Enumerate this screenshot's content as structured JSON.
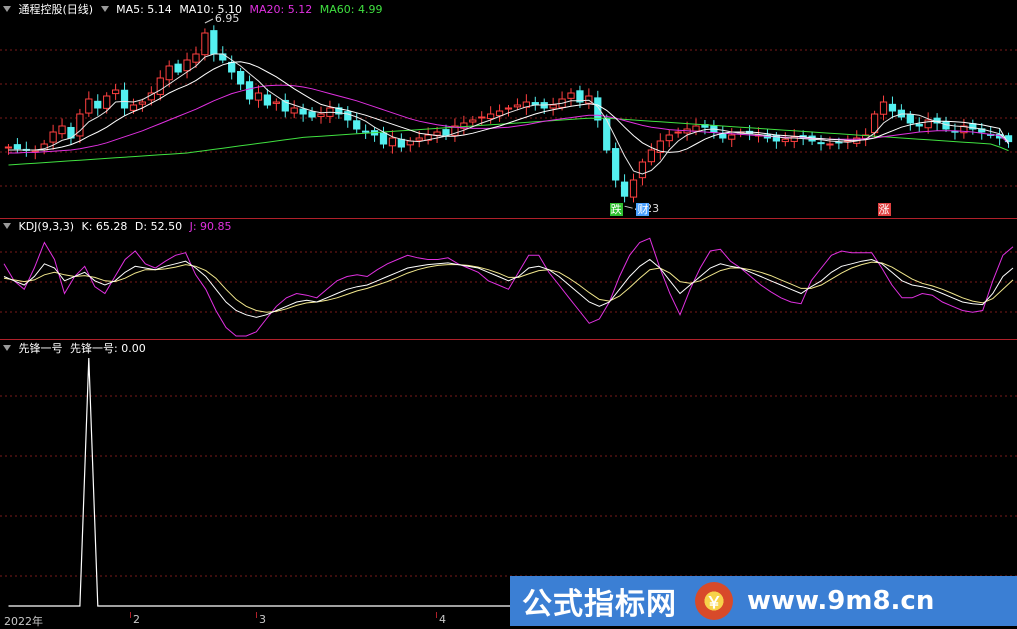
{
  "chart_data": [
    {
      "type": "candlestick",
      "title": "通程控股(日线)",
      "legend": [
        {
          "label": "MA5: 5.14",
          "color": "#ffffff"
        },
        {
          "label": "MA10: 5.10",
          "color": "#ffffff"
        },
        {
          "label": "MA20: 5.12",
          "color": "#e030e0"
        },
        {
          "label": "MA60: 4.99",
          "color": "#40e040"
        }
      ],
      "annotations": {
        "high_label": "6.95",
        "low_label": "4.23"
      },
      "tags": [
        {
          "text": "跌",
          "color": "#30c030"
        },
        {
          "text": "财",
          "color": "#4aa0ff"
        },
        {
          "text": "涨",
          "color": "#e04040"
        }
      ],
      "ylim": [
        4.0,
        7.2
      ],
      "close": [
        5.05,
        5.02,
        5.0,
        4.98,
        5.1,
        5.3,
        5.4,
        5.2,
        5.6,
        5.85,
        5.7,
        5.9,
        6.0,
        5.7,
        5.75,
        5.8,
        5.95,
        6.2,
        6.4,
        6.3,
        6.5,
        6.6,
        6.95,
        6.6,
        6.5,
        6.3,
        6.1,
        5.85,
        5.95,
        5.75,
        5.8,
        5.65,
        5.7,
        5.6,
        5.55,
        5.6,
        5.7,
        5.6,
        5.5,
        5.35,
        5.3,
        5.25,
        5.1,
        5.2,
        5.05,
        5.15,
        5.2,
        5.25,
        5.3,
        5.25,
        5.4,
        5.45,
        5.5,
        5.55,
        5.6,
        5.65,
        5.7,
        5.75,
        5.8,
        5.75,
        5.7,
        5.75,
        5.85,
        5.95,
        5.8,
        5.9,
        5.5,
        5.0,
        4.5,
        4.23,
        4.5,
        4.8,
        5.0,
        5.15,
        5.25,
        5.3,
        5.35,
        5.4,
        5.38,
        5.3,
        5.2,
        5.25,
        5.3,
        5.28,
        5.25,
        5.2,
        5.15,
        5.18,
        5.22,
        5.2,
        5.15,
        5.12,
        5.1,
        5.12,
        5.15,
        5.2,
        5.25,
        5.6,
        5.8,
        5.65,
        5.55,
        5.45,
        5.4,
        5.5,
        5.45,
        5.35,
        5.3,
        5.4,
        5.35,
        5.3,
        5.25,
        5.2,
        5.14
      ],
      "ma5": [
        5.0,
        5.0,
        5.0,
        5.0,
        5.02,
        5.08,
        5.16,
        5.2,
        5.32,
        5.47,
        5.55,
        5.65,
        5.8,
        5.81,
        5.8,
        5.84,
        5.92,
        6.0,
        6.1,
        6.2,
        6.3,
        6.4,
        6.55,
        6.6,
        6.6,
        6.5,
        6.4,
        6.27,
        6.15,
        6.0,
        5.9,
        5.8,
        5.75,
        5.7,
        5.65,
        5.62,
        5.63,
        5.62,
        5.6,
        5.55,
        5.48,
        5.38,
        5.3,
        5.22,
        5.18,
        5.15,
        5.14,
        5.17,
        5.2,
        5.23,
        5.28,
        5.33,
        5.39,
        5.45,
        5.5,
        5.56,
        5.62,
        5.67,
        5.72,
        5.75,
        5.75,
        5.76,
        5.78,
        5.82,
        5.82,
        5.83,
        5.72,
        5.5,
        5.2,
        4.9,
        4.65,
        4.6,
        4.66,
        4.8,
        5.0,
        5.15,
        5.25,
        5.3,
        5.34,
        5.35,
        5.33,
        5.3,
        5.28,
        5.27,
        5.26,
        5.24,
        5.22,
        5.2,
        5.2,
        5.19,
        5.18,
        5.17,
        5.15,
        5.14,
        5.13,
        5.15,
        5.18,
        5.28,
        5.45,
        5.55,
        5.6,
        5.6,
        5.58,
        5.52,
        5.47,
        5.42,
        5.4,
        5.39,
        5.37,
        5.35,
        5.31,
        5.27,
        5.14
      ],
      "ma10": [
        5.0,
        5.0,
        5.0,
        5.0,
        5.0,
        5.02,
        5.05,
        5.09,
        5.15,
        5.23,
        5.3,
        5.38,
        5.48,
        5.57,
        5.64,
        5.7,
        5.78,
        5.86,
        5.95,
        6.02,
        6.08,
        6.16,
        6.26,
        6.35,
        6.42,
        6.46,
        6.47,
        6.44,
        6.38,
        6.3,
        6.22,
        6.12,
        6.02,
        5.93,
        5.84,
        5.76,
        5.72,
        5.69,
        5.66,
        5.62,
        5.58,
        5.53,
        5.48,
        5.43,
        5.38,
        5.33,
        5.28,
        5.26,
        5.24,
        5.23,
        5.23,
        5.25,
        5.28,
        5.32,
        5.36,
        5.4,
        5.45,
        5.5,
        5.55,
        5.6,
        5.64,
        5.67,
        5.7,
        5.73,
        5.75,
        5.77,
        5.75,
        5.66,
        5.53,
        5.38,
        5.24,
        5.12,
        5.04,
        4.98,
        4.96,
        4.97,
        5.02,
        5.1,
        5.18,
        5.24,
        5.28,
        5.3,
        5.3,
        5.3,
        5.29,
        5.27,
        5.25,
        5.24,
        5.23,
        5.22,
        5.2,
        5.19,
        5.18,
        5.17,
        5.16,
        5.16,
        5.17,
        5.2,
        5.26,
        5.32,
        5.38,
        5.42,
        5.45,
        5.47,
        5.48,
        5.48,
        5.47,
        5.46,
        5.44,
        5.42,
        5.39,
        5.36,
        5.1
      ],
      "ma20": [
        4.95,
        4.95,
        4.96,
        4.96,
        4.97,
        4.98,
        4.99,
        5.0,
        5.02,
        5.05,
        5.08,
        5.12,
        5.17,
        5.22,
        5.27,
        5.32,
        5.38,
        5.44,
        5.5,
        5.56,
        5.62,
        5.68,
        5.75,
        5.82,
        5.88,
        5.94,
        5.98,
        6.02,
        6.05,
        6.07,
        6.08,
        6.08,
        6.07,
        6.05,
        6.02,
        5.98,
        5.94,
        5.9,
        5.86,
        5.82,
        5.77,
        5.72,
        5.67,
        5.62,
        5.57,
        5.52,
        5.48,
        5.45,
        5.42,
        5.4,
        5.38,
        5.37,
        5.36,
        5.36,
        5.36,
        5.37,
        5.38,
        5.4,
        5.42,
        5.45,
        5.48,
        5.5,
        5.52,
        5.54,
        5.56,
        5.58,
        5.58,
        5.56,
        5.53,
        5.49,
        5.45,
        5.41,
        5.38,
        5.36,
        5.34,
        5.33,
        5.32,
        5.31,
        5.3,
        5.29,
        5.28,
        5.27,
        5.26,
        5.25,
        5.24,
        5.23,
        5.22,
        5.21,
        5.2,
        5.2,
        5.19,
        5.19,
        5.18,
        5.18,
        5.18,
        5.18,
        5.19,
        5.2,
        5.22,
        5.24,
        5.26,
        5.28,
        5.3,
        5.31,
        5.32,
        5.32,
        5.32,
        5.31,
        5.3,
        5.28,
        5.26,
        5.24,
        5.12
      ],
      "ma60": [
        4.75,
        4.76,
        4.77,
        4.78,
        4.79,
        4.8,
        4.81,
        4.82,
        4.83,
        4.84,
        4.85,
        4.86,
        4.87,
        4.88,
        4.89,
        4.9,
        4.91,
        4.92,
        4.93,
        4.94,
        4.95,
        4.97,
        4.99,
        5.01,
        5.03,
        5.05,
        5.07,
        5.09,
        5.11,
        5.13,
        5.15,
        5.17,
        5.19,
        5.21,
        5.22,
        5.23,
        5.24,
        5.25,
        5.26,
        5.27,
        5.28,
        5.29,
        5.3,
        5.31,
        5.32,
        5.33,
        5.34,
        5.35,
        5.36,
        5.37,
        5.38,
        5.39,
        5.4,
        5.41,
        5.42,
        5.43,
        5.44,
        5.45,
        5.46,
        5.47,
        5.48,
        5.49,
        5.5,
        5.51,
        5.52,
        5.53,
        5.53,
        5.53,
        5.52,
        5.51,
        5.5,
        5.49,
        5.48,
        5.47,
        5.46,
        5.45,
        5.44,
        5.43,
        5.42,
        5.41,
        5.4,
        5.39,
        5.38,
        5.37,
        5.36,
        5.35,
        5.34,
        5.33,
        5.32,
        5.31,
        5.3,
        5.29,
        5.28,
        5.27,
        5.26,
        5.25,
        5.24,
        5.23,
        5.22,
        5.21,
        5.2,
        5.19,
        5.18,
        5.17,
        5.16,
        5.15,
        5.14,
        5.13,
        5.12,
        5.11,
        5.1,
        5.05,
        4.99
      ]
    },
    {
      "type": "line",
      "title": "KDJ(9,3,3)",
      "legend": [
        {
          "label": "K: 65.28",
          "color": "#ffffff"
        },
        {
          "label": "D: 52.50",
          "color": "#ffffff"
        },
        {
          "label": "J: 90.85",
          "color": "#e030e0"
        }
      ],
      "ylim": [
        -10,
        110
      ],
      "K": [
        60,
        55,
        50,
        60,
        75,
        70,
        55,
        60,
        65,
        55,
        50,
        55,
        65,
        72,
        70,
        68,
        72,
        75,
        78,
        70,
        60,
        45,
        30,
        20,
        15,
        12,
        15,
        20,
        25,
        30,
        32,
        30,
        35,
        40,
        45,
        48,
        50,
        55,
        60,
        65,
        70,
        72,
        74,
        75,
        76,
        74,
        72,
        70,
        65,
        60,
        55,
        60,
        70,
        72,
        68,
        60,
        50,
        40,
        30,
        25,
        30,
        45,
        60,
        72,
        80,
        70,
        55,
        40,
        50,
        60,
        70,
        75,
        72,
        70,
        65,
        60,
        55,
        50,
        45,
        40,
        48,
        55,
        65,
        72,
        75,
        78,
        80,
        75,
        65,
        55,
        50,
        48,
        45,
        40,
        35,
        30,
        28,
        27,
        40,
        60,
        70
      ],
      "D": [
        58,
        56,
        54,
        56,
        62,
        65,
        62,
        60,
        61,
        59,
        55,
        54,
        58,
        64,
        68,
        68,
        69,
        71,
        74,
        72,
        67,
        58,
        45,
        33,
        25,
        20,
        18,
        19,
        22,
        26,
        29,
        30,
        32,
        35,
        39,
        43,
        46,
        50,
        54,
        59,
        64,
        68,
        71,
        73,
        74,
        74,
        73,
        71,
        68,
        64,
        59,
        59,
        63,
        67,
        68,
        65,
        58,
        50,
        41,
        33,
        31,
        37,
        47,
        58,
        68,
        70,
        64,
        54,
        52,
        55,
        61,
        67,
        70,
        70,
        68,
        65,
        61,
        56,
        51,
        46,
        46,
        50,
        57,
        64,
        70,
        74,
        77,
        76,
        71,
        64,
        57,
        52,
        49,
        45,
        40,
        35,
        31,
        29,
        34,
        45,
        56
      ],
      "J": [
        75,
        55,
        45,
        70,
        100,
        80,
        40,
        60,
        72,
        48,
        40,
        60,
        80,
        90,
        75,
        70,
        78,
        85,
        88,
        62,
        45,
        20,
        0,
        -10,
        -10,
        -5,
        10,
        25,
        35,
        40,
        38,
        35,
        45,
        55,
        60,
        62,
        60,
        68,
        75,
        80,
        85,
        82,
        80,
        80,
        82,
        75,
        70,
        65,
        55,
        50,
        45,
        65,
        85,
        85,
        65,
        50,
        35,
        20,
        5,
        10,
        30,
        60,
        85,
        100,
        105,
        70,
        40,
        15,
        45,
        70,
        90,
        92,
        78,
        70,
        60,
        50,
        42,
        35,
        30,
        28,
        55,
        70,
        85,
        90,
        88,
        88,
        88,
        70,
        50,
        35,
        35,
        40,
        38,
        30,
        25,
        20,
        18,
        20,
        55,
        85,
        95
      ]
    },
    {
      "type": "line",
      "title": "先锋一号",
      "legend": [
        {
          "label": "先锋一号: 0.00",
          "color": "#ffffff"
        }
      ],
      "ylim": [
        0,
        1
      ],
      "spike_index": 9,
      "values": [
        0,
        0,
        0,
        0,
        0,
        0,
        0,
        0,
        0,
        1,
        0,
        0,
        0,
        0,
        0,
        0,
        0,
        0,
        0,
        0,
        0,
        0,
        0,
        0,
        0,
        0,
        0,
        0,
        0,
        0,
        0,
        0,
        0,
        0,
        0,
        0,
        0,
        0,
        0,
        0,
        0,
        0,
        0,
        0,
        0,
        0,
        0,
        0,
        0,
        0,
        0,
        0,
        0,
        0,
        0,
        0,
        0,
        0,
        0,
        0,
        0,
        0,
        0,
        0,
        0,
        0,
        0,
        0,
        0,
        0,
        0,
        0,
        0,
        0,
        0,
        0,
        0,
        0,
        0,
        0,
        0,
        0,
        0,
        0,
        0,
        0,
        0,
        0,
        0,
        0,
        0,
        0,
        0,
        0,
        0,
        0,
        0,
        0,
        0,
        0,
        0,
        0,
        0,
        0,
        0,
        0,
        0,
        0,
        0,
        0,
        0,
        0,
        0,
        0,
        0,
        0,
        0
      ]
    }
  ],
  "x_axis": {
    "labels": [
      "2022年",
      "2",
      "3",
      "4"
    ]
  },
  "watermark": {
    "cn": "公式指标网",
    "logo": "￥",
    "url": "www.9m8.cn"
  }
}
